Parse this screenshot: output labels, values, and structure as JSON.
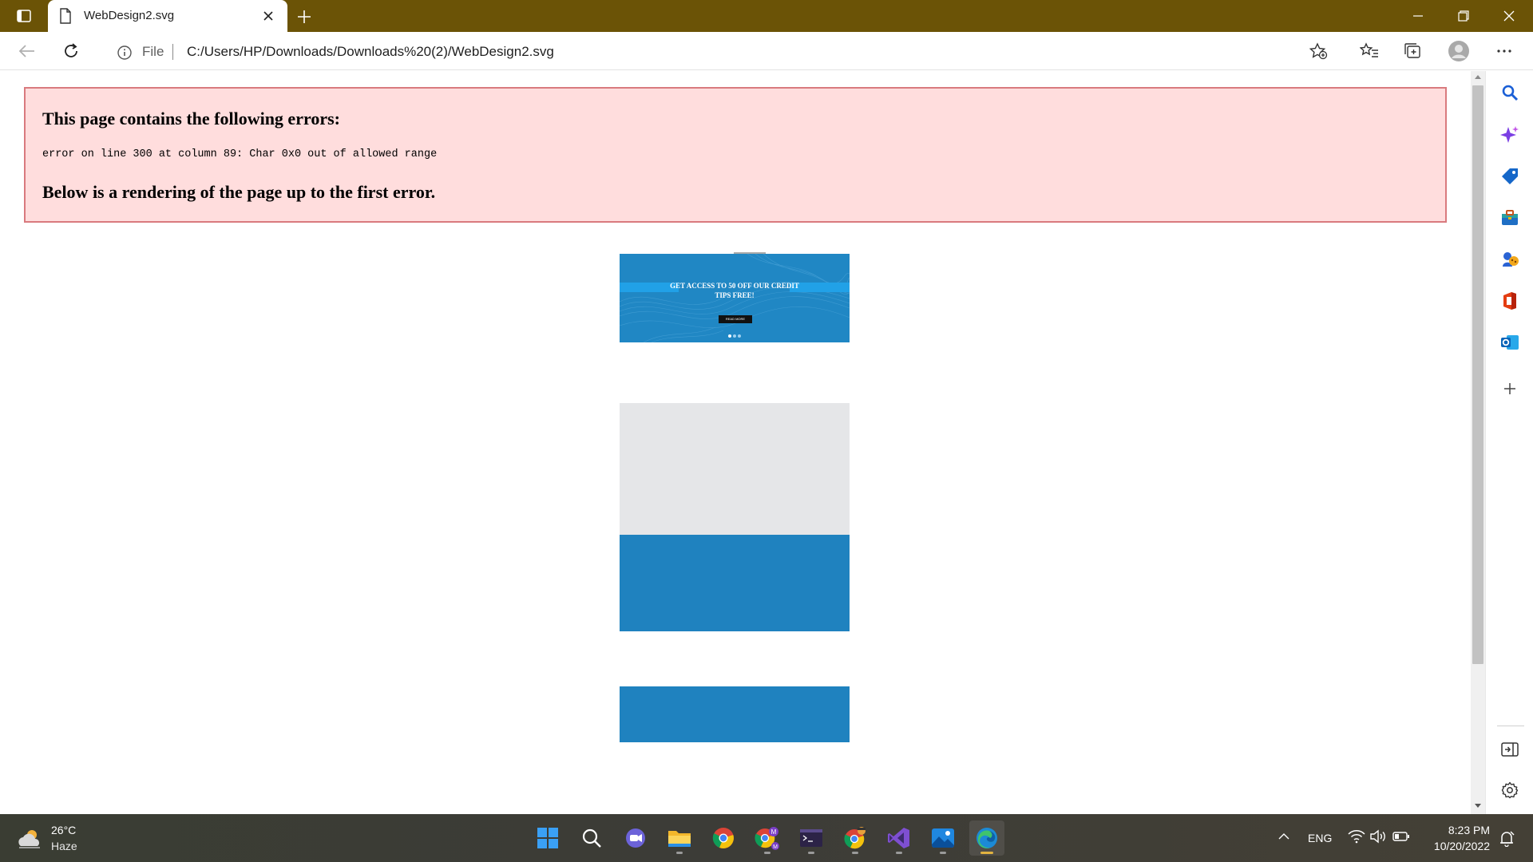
{
  "browser": {
    "tab_title": "WebDesign2.svg",
    "address_scheme_label": "File",
    "url": "C:/Users/HP/Downloads/Downloads%20(2)/WebDesign2.svg"
  },
  "page": {
    "error_heading": "This page contains the following errors:",
    "error_message": "error on line 300 at column 89: Char 0x0 out of allowed range",
    "render_note": "Below is a rendering of the page up to the first error.",
    "banner": {
      "headline": "GET ACCESS TO 50 OFF OUR CREDIT TIPS FREE!",
      "button_label": "READ MORE",
      "slide_count": 3,
      "active_slide": 1
    },
    "colors": {
      "error_bg": "#ffdddd",
      "error_border": "#d97a7e",
      "banner_blue": "#2087c4",
      "block_grey": "#e5e6e8",
      "block_blue": "#1f82bf"
    }
  },
  "sidebar": {
    "items": [
      "search-icon",
      "sparkle-icon",
      "tag-icon",
      "toolbox-icon",
      "games-icon",
      "office-icon",
      "outlook-icon",
      "add-icon"
    ],
    "bottom_items": [
      "hide-sidebar-icon",
      "settings-icon"
    ]
  },
  "taskbar": {
    "weather_temp": "26°C",
    "weather_desc": "Haze",
    "apps": [
      "start",
      "search",
      "teams-chat",
      "file-explorer",
      "chrome",
      "chrome-profile",
      "terminal",
      "chrome-canary",
      "visual-studio",
      "photos",
      "edge"
    ],
    "language": "ENG",
    "time": "8:23 PM",
    "date": "10/20/2022"
  }
}
